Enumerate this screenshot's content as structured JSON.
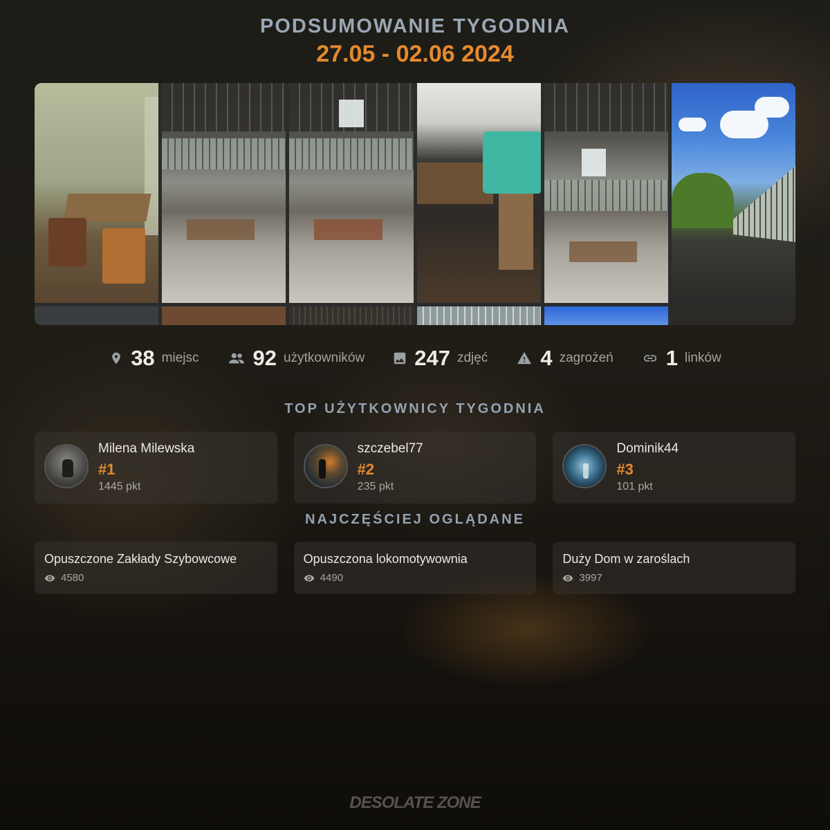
{
  "header": {
    "title": "PODSUMOWANIE TYGODNIA",
    "date_range": "27.05 - 02.06 2024"
  },
  "stats": [
    {
      "icon": "location-pin-icon",
      "value": "38",
      "label": "miejsc"
    },
    {
      "icon": "users-icon",
      "value": "92",
      "label": "użytkowników"
    },
    {
      "icon": "image-icon",
      "value": "247",
      "label": "zdjęć"
    },
    {
      "icon": "warning-icon",
      "value": "4",
      "label": "zagrożeń"
    },
    {
      "icon": "link-icon",
      "value": "1",
      "label": "linków"
    }
  ],
  "top_users": {
    "title": "TOP UŻYTKOWNICY TYGODNIA",
    "items": [
      {
        "name": "Milena Milewska",
        "rank": "#1",
        "points": "1445 pkt"
      },
      {
        "name": "szczebel77",
        "rank": "#2",
        "points": "235 pkt"
      },
      {
        "name": "Dominik44",
        "rank": "#3",
        "points": "101 pkt"
      }
    ]
  },
  "most_viewed": {
    "title": "NAJCZĘŚCIEJ OGLĄDANE",
    "items": [
      {
        "name": "Opuszczone Zakłady Szybowcowe",
        "views": "4580"
      },
      {
        "name": "Opuszczona lokomotywownia",
        "views": "4490"
      },
      {
        "name": "Duży Dom w zaroślach",
        "views": "3997"
      }
    ]
  },
  "brand": "DESOLATE ZONE",
  "colors": {
    "accent": "#e48a2f",
    "title": "#9aa7b3"
  }
}
